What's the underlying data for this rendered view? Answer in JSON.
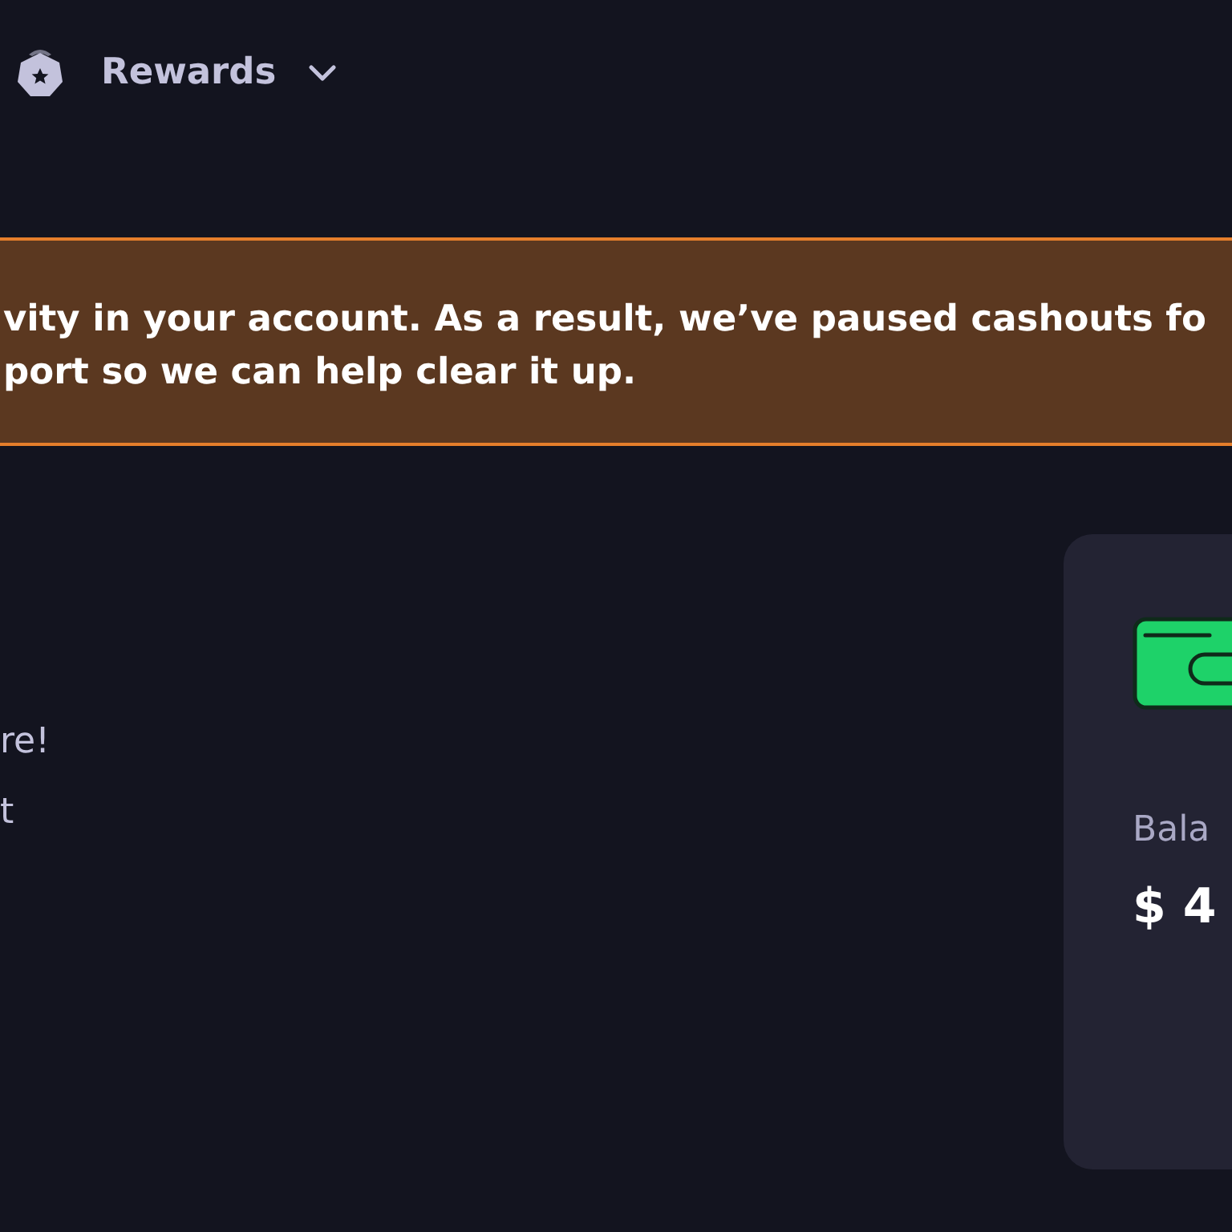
{
  "nav": {
    "label": "Rewards",
    "expanded": false
  },
  "alert": {
    "lines": [
      "vity in your account. As a result, we’ve paused cashouts fo",
      "port so we can help clear it up."
    ]
  },
  "intro": {
    "lines": [
      "re!",
      "t"
    ]
  },
  "balance_card": {
    "label": "Bala",
    "amount": "$ 4"
  }
}
